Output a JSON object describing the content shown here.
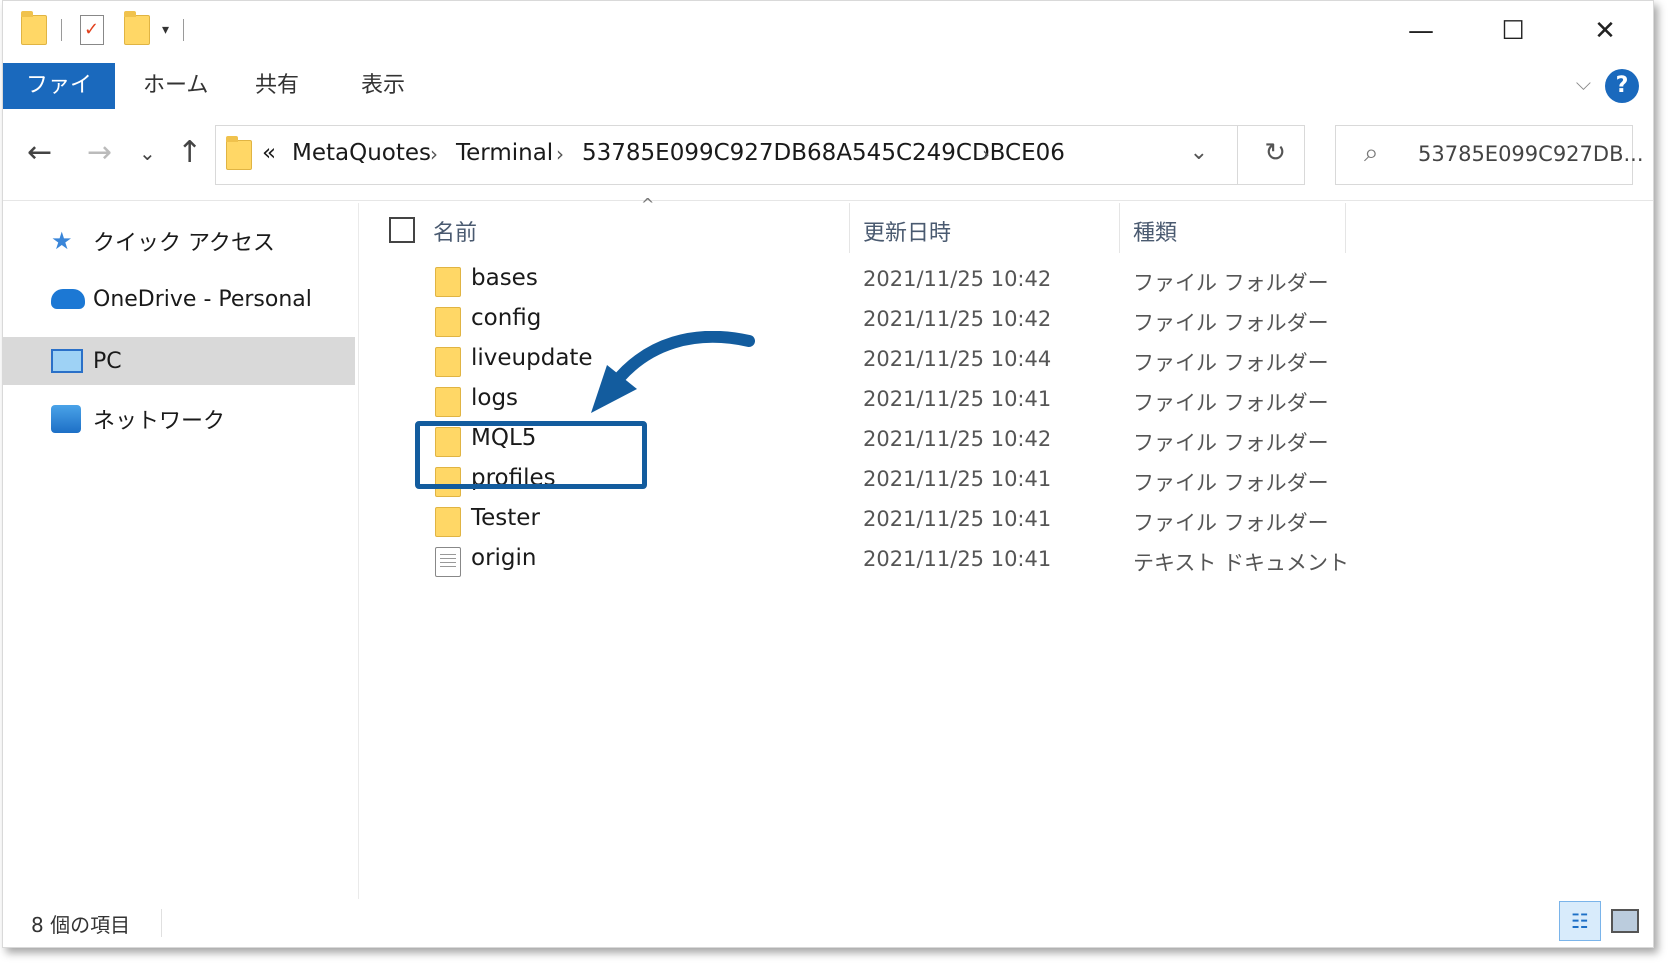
{
  "window": {
    "quick_access_toolbar": [
      "folder-icon",
      "properties-icon",
      "new-folder-icon",
      "customize-dropdown-icon"
    ],
    "controls": {
      "minimize": "—",
      "maximize": "☐",
      "close": "✕"
    }
  },
  "ribbon": {
    "tabs": [
      {
        "label": "ファイル",
        "active": true
      },
      {
        "label": "ホーム",
        "active": false
      },
      {
        "label": "共有",
        "active": false
      },
      {
        "label": "表示",
        "active": false
      }
    ],
    "collapse_icon": "⌵",
    "help_icon": "?"
  },
  "navigation": {
    "back": "←",
    "forward": "→",
    "recent": "⌄",
    "up": "↑"
  },
  "address": {
    "overflow": "«",
    "crumbs": [
      "MetaQuotes",
      "Terminal",
      "53785E099C927DB68A545C249CDBCE06"
    ],
    "separator": "›",
    "dropdown": "⌄",
    "refresh": "↻"
  },
  "search": {
    "icon": "⌕",
    "placeholder": "53785E099C927DB..."
  },
  "nav_pane": {
    "items": [
      {
        "label": "クイック アクセス",
        "icon": "star-icon"
      },
      {
        "label": "OneDrive - Personal",
        "icon": "cloud-icon"
      },
      {
        "label": "PC",
        "icon": "computer-icon",
        "selected": true
      },
      {
        "label": "ネットワーク",
        "icon": "network-icon"
      }
    ]
  },
  "columns": {
    "name": "名前",
    "modified": "更新日時",
    "type": "種類",
    "sort_icon": "^"
  },
  "files": [
    {
      "name": "bases",
      "modified": "2021/11/25 10:42",
      "type": "ファイル フォルダー",
      "kind": "folder"
    },
    {
      "name": "config",
      "modified": "2021/11/25 10:42",
      "type": "ファイル フォルダー",
      "kind": "folder"
    },
    {
      "name": "liveupdate",
      "modified": "2021/11/25 10:44",
      "type": "ファイル フォルダー",
      "kind": "folder"
    },
    {
      "name": "logs",
      "modified": "2021/11/25 10:41",
      "type": "ファイル フォルダー",
      "kind": "folder"
    },
    {
      "name": "MQL5",
      "modified": "2021/11/25 10:42",
      "type": "ファイル フォルダー",
      "kind": "folder"
    },
    {
      "name": "profiles",
      "modified": "2021/11/25 10:41",
      "type": "ファイル フォルダー",
      "kind": "folder"
    },
    {
      "name": "Tester",
      "modified": "2021/11/25 10:41",
      "type": "ファイル フォルダー",
      "kind": "folder"
    },
    {
      "name": "origin",
      "modified": "2021/11/25 10:41",
      "type": "テキスト ドキュメント",
      "kind": "text"
    }
  ],
  "status": {
    "item_count": "8 個の項目"
  },
  "annotation": {
    "highlight_color": "#135c9e"
  }
}
